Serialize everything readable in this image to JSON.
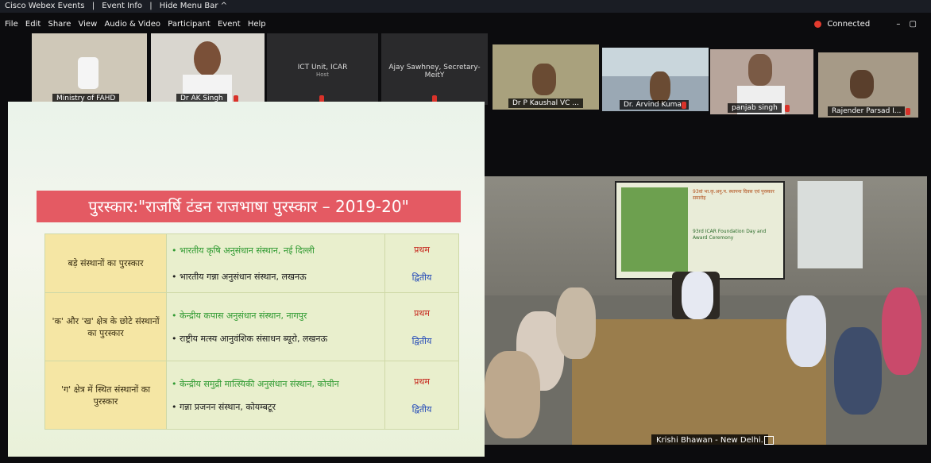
{
  "topbar": {
    "app": "Cisco Webex Events",
    "event_info": "Event Info",
    "hide_menu": "Hide Menu Bar ^"
  },
  "menu": [
    "File",
    "Edit",
    "Share",
    "View",
    "Audio & Video",
    "Participant",
    "Event",
    "Help"
  ],
  "status": {
    "connected": "Connected"
  },
  "participants": [
    {
      "name": "Ministry of FAHD"
    },
    {
      "name": "Dr AK Singh"
    },
    {
      "name": "ICT Unit, ICAR",
      "sub": "Host"
    },
    {
      "name": "Ajay Sawhney, Secretary-MeitY"
    },
    {
      "name": "Dr P Kaushal VC ..."
    },
    {
      "name": "Dr. Arvind Kumar"
    },
    {
      "name": "panjab singh"
    },
    {
      "name": "Rajender Parsad I..."
    }
  ],
  "slide": {
    "title": "पुरस्कार:\"राजर्षि टंडन राजभाषा पुरस्कार – 2019-20\"",
    "rows": [
      {
        "category": "बड़े संस्थानों का पुरस्कार",
        "first": "• भारतीय कृषि अनुसंधान संस्थान, नई दिल्ली",
        "second": "• भारतीय गन्ना अनुसंधान संस्थान, लखनऊ",
        "r1": "प्रथम",
        "r2": "द्वितीय"
      },
      {
        "category": "'क' और 'ख' क्षेत्र के छोटे संस्थानों का पुरस्कार",
        "first": "• केन्द्रीय कपास अनुसंधान संस्थान, नागपुर",
        "second": "• राष्ट्रीय मत्स्य आनुवंशिक संसाधन ब्यूरो, लखनऊ",
        "r1": "प्रथम",
        "r2": "द्वितीय"
      },
      {
        "category": "'ग' क्षेत्र में स्थित संस्थानों का पुरस्कार",
        "first": "• केन्द्रीय समुद्री मात्स्यिकी अनुसंधान संस्थान, कोचीन",
        "second": "• गन्ना प्रजनन संस्थान, कोयम्बटूर",
        "r1": "प्रथम",
        "r2": "द्वितीय"
      }
    ]
  },
  "video": {
    "label": "Krishi Bhawan - New Delhi.",
    "screen_hi": "93वां भा.कृ.अनु.प. स्थापना दिवस एवं पुरस्कार समारोह",
    "screen_en": "93rd ICAR Foundation Day and Award Ceremony"
  },
  "colors": {
    "slide_title_bg": "#e45a63",
    "first_rank": "#c6261c",
    "second_rank": "#1f46b8"
  }
}
